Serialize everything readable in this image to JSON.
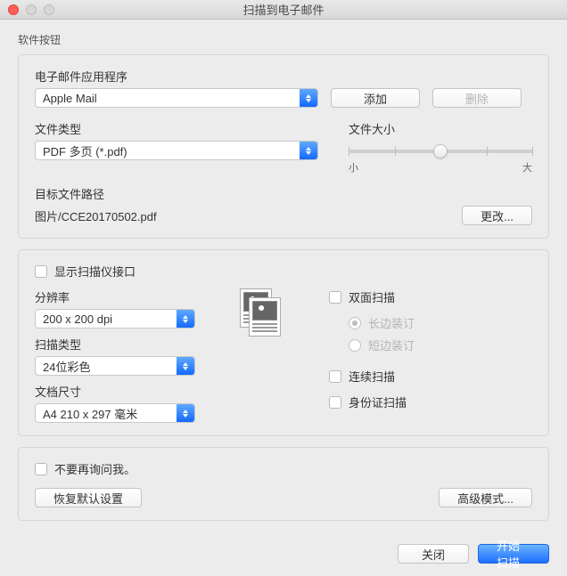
{
  "window": {
    "title": "扫描到电子邮件"
  },
  "sectionLabel": "软件按钮",
  "email": {
    "label": "电子邮件应用程序",
    "value": "Apple Mail",
    "addBtn": "添加",
    "deleteBtn": "删除"
  },
  "fileType": {
    "label": "文件类型",
    "value": "PDF 多页 (*.pdf)"
  },
  "fileSize": {
    "label": "文件大小",
    "small": "小",
    "large": "大",
    "value": 50
  },
  "destPath": {
    "label": "目标文件路径",
    "value": "图片/CCE20170502.pdf",
    "changeBtn": "更改..."
  },
  "showScanner": {
    "label": "显示扫描仪接口",
    "checked": false
  },
  "resolution": {
    "label": "分辨率",
    "value": "200 x 200 dpi"
  },
  "scanType": {
    "label": "扫描类型",
    "value": "24位彩色"
  },
  "docSize": {
    "label": "文档尺寸",
    "value": "A4 210 x 297 毫米"
  },
  "duplex": {
    "label": "双面扫描",
    "checked": false,
    "longEdge": "长边装订",
    "shortEdge": "短边装订",
    "binding": "long"
  },
  "continuous": {
    "label": "连续扫描",
    "checked": false
  },
  "idCard": {
    "label": "身份证扫描",
    "checked": false
  },
  "dontAsk": {
    "label": "不要再询问我。",
    "checked": false
  },
  "restoreBtn": "恢复默认设置",
  "advancedBtn": "高级模式...",
  "closeBtn": "关闭",
  "startBtn": "开始扫描"
}
